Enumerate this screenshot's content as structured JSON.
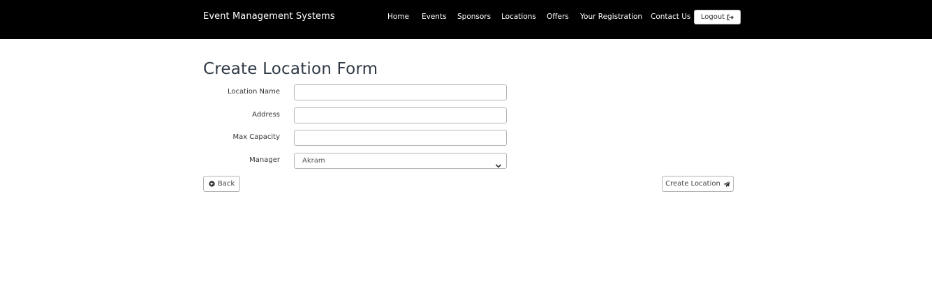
{
  "navbar": {
    "brand": "Event Management Systems",
    "links": [
      "Home",
      "Events",
      "Sponsors",
      "Locations",
      "Offers",
      "Your Registration",
      "Contact Us"
    ],
    "logout_label": "Logout"
  },
  "page": {
    "title": "Create Location Form"
  },
  "form": {
    "location_name": {
      "label": "Location Name",
      "value": ""
    },
    "address": {
      "label": "Address",
      "value": ""
    },
    "max_capacity": {
      "label": "Max Capacity",
      "value": ""
    },
    "manager": {
      "label": "Manager",
      "selected": "Akram"
    }
  },
  "actions": {
    "back_label": "Back",
    "create_label": "Create Location"
  },
  "icons": {
    "logout": "sign-out-icon",
    "back": "circle-arrow-left-icon",
    "create": "paper-plane-icon",
    "select": "chevron-down-icon"
  }
}
